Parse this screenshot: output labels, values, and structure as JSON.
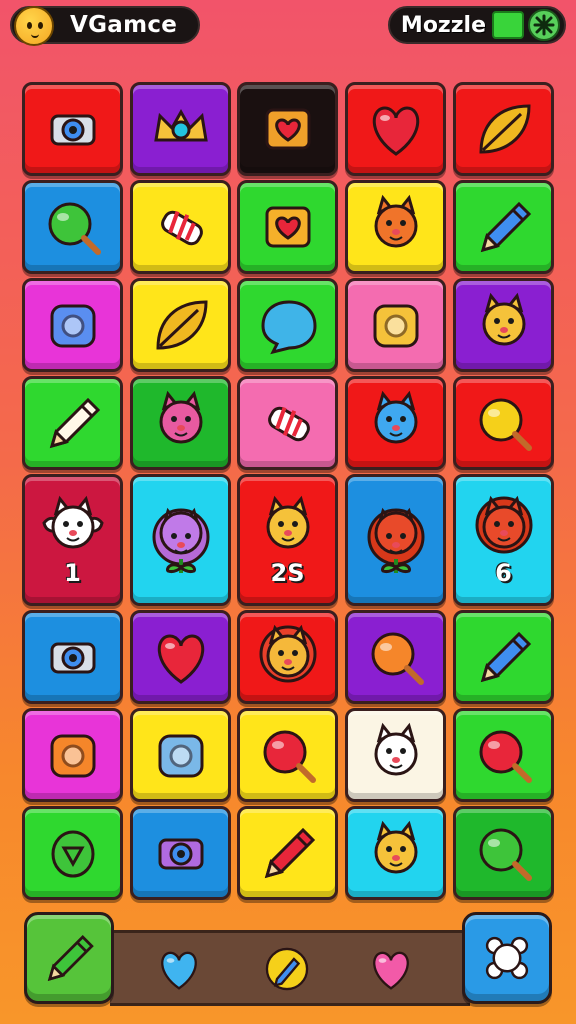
{
  "header": {
    "app_title": "VGamce",
    "mode_label": "Mozzle"
  },
  "colors": {
    "red": "#f01818",
    "purple": "#8a1fd1",
    "black": "#1a1010",
    "blue": "#1d8fe0",
    "yellow": "#ffe51a",
    "green": "#2fd82f",
    "magenta": "#e834d8",
    "pink": "#f46cb0",
    "crimson": "#cc1740",
    "cyan": "#22d4ef",
    "cream": "#fbf5e4",
    "darkgreen": "#1fb82c"
  },
  "board": {
    "rows": [
      [
        {
          "bg": "red",
          "icon": "gear-knot-icon"
        },
        {
          "bg": "purple",
          "icon": "crown-gem-icon"
        },
        {
          "bg": "black",
          "icon": "framed-heart-icon"
        },
        {
          "bg": "red",
          "icon": "heart-icon"
        },
        {
          "bg": "red",
          "icon": "leaf-icon"
        }
      ],
      [
        {
          "bg": "blue",
          "icon": "green-ball-icon"
        },
        {
          "bg": "yellow",
          "icon": "candy-stick-icon"
        },
        {
          "bg": "green",
          "icon": "heart-box-icon"
        },
        {
          "bg": "yellow",
          "icon": "fox-face-icon"
        },
        {
          "bg": "green",
          "icon": "pencil-icon"
        }
      ],
      [
        {
          "bg": "magenta",
          "icon": "clock-icon"
        },
        {
          "bg": "yellow",
          "icon": "leaf-icon"
        },
        {
          "bg": "green",
          "icon": "speech-bubble-icon"
        },
        {
          "bg": "pink",
          "icon": "shell-cone-icon"
        },
        {
          "bg": "purple",
          "icon": "scroll-face-icon"
        }
      ],
      [
        {
          "bg": "green",
          "icon": "chalk-icon"
        },
        {
          "bg": "darkgreen",
          "icon": "cat-face-icon"
        },
        {
          "bg": "pink",
          "icon": "candy-icon"
        },
        {
          "bg": "red",
          "icon": "bunny-face-icon"
        },
        {
          "bg": "red",
          "icon": "lemon-lolly-icon"
        }
      ],
      [
        {
          "bg": "crimson",
          "icon": "winged-cat-icon",
          "num": "1"
        },
        {
          "bg": "cyan",
          "icon": "purple-lion-flower-icon"
        },
        {
          "bg": "red",
          "icon": "lion-face-icon",
          "num": "2S"
        },
        {
          "bg": "blue",
          "icon": "red-lion-flower-icon"
        },
        {
          "bg": "cyan",
          "icon": "red-lion-icon",
          "num": "6"
        }
      ],
      [
        {
          "bg": "blue",
          "icon": "eye-chip-icon"
        },
        {
          "bg": "purple",
          "icon": "heart-icon"
        },
        {
          "bg": "red",
          "icon": "lion-mane-icon"
        },
        {
          "bg": "purple",
          "icon": "orange-lolly-icon"
        },
        {
          "bg": "green",
          "icon": "pencil-icon"
        }
      ],
      [
        {
          "bg": "magenta",
          "icon": "orange-badge-icon"
        },
        {
          "bg": "yellow",
          "icon": "tv-screen-icon"
        },
        {
          "bg": "yellow",
          "icon": "red-lolly-icon"
        },
        {
          "bg": "cream",
          "icon": "cow-face-icon"
        },
        {
          "bg": "green",
          "icon": "red-lolly-icon"
        }
      ],
      [
        {
          "bg": "green",
          "icon": "turtle-icon"
        },
        {
          "bg": "blue",
          "icon": "purple-gear-icon"
        },
        {
          "bg": "yellow",
          "icon": "red-pencil-icon"
        },
        {
          "bg": "cyan",
          "icon": "lion-cub-icon"
        },
        {
          "bg": "darkgreen",
          "icon": "green-blob-icon"
        }
      ]
    ]
  },
  "tray": {
    "left_button_icon": "green-pencil-icon",
    "right_button_icon": "white-bone-icon",
    "items": [
      "blue-heart-icon",
      "yellow-pencil-coin-icon",
      "pink-heart-icon"
    ]
  }
}
